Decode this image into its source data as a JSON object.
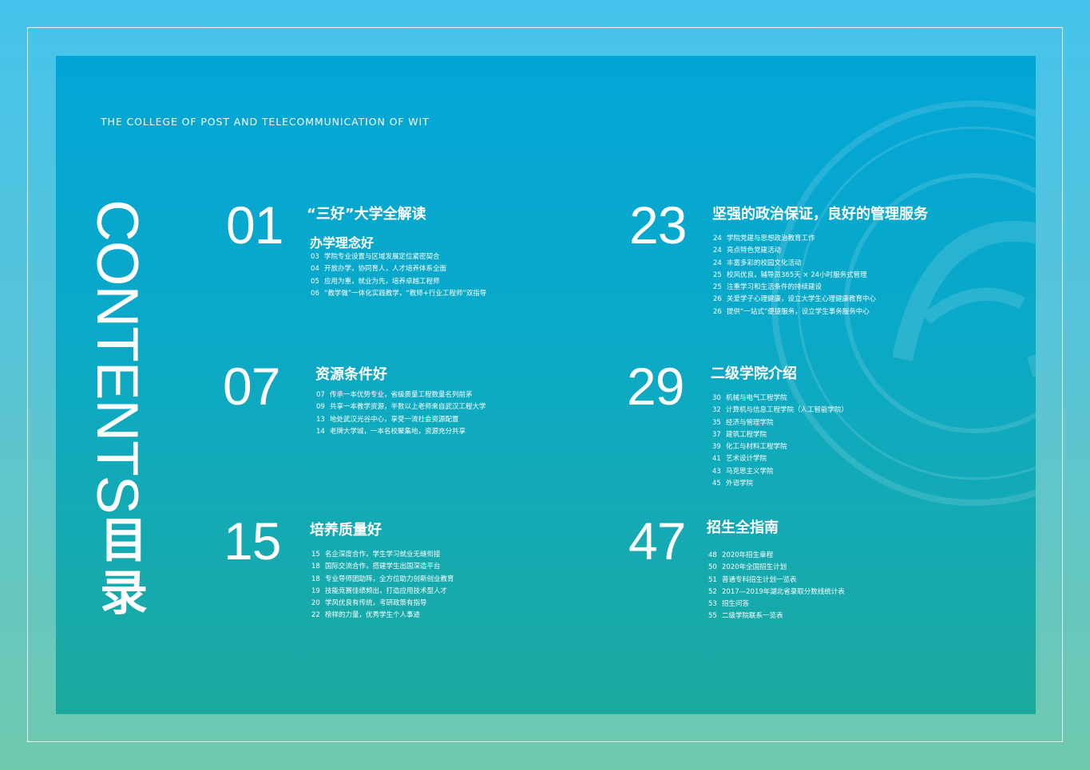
{
  "subtitle": "THE COLLEGE OF POST AND TELECOMMUNICATION OF WIT",
  "contents_word": "CONTENTS",
  "mulu_1": "目",
  "mulu_2": "录",
  "sections": [
    {
      "num": "01",
      "title": "“三好”大学全解读",
      "subtitle": "办学理念好",
      "items": [
        {
          "page": "03",
          "text": "学院专业设置与区域发展定位紧密契合"
        },
        {
          "page": "04",
          "text": "开放办学，协同育人，人才培养体系全面"
        },
        {
          "page": "05",
          "text": "应用为重，就业为先，培养卓越工程师"
        },
        {
          "page": "06",
          "text": "“教学做”一体化实践教学，“教师+行业工程师”双指导"
        }
      ]
    },
    {
      "num": "07",
      "title": "资源条件好",
      "items": [
        {
          "page": "07",
          "text": "传承一本优势专业，省级质量工程数量名列前茅"
        },
        {
          "page": "09",
          "text": "共享一本教学资源，半数以上老师来自武汉工程大学"
        },
        {
          "page": "13",
          "text": "地处武汉光谷中心，享受一流社会资源配置"
        },
        {
          "page": "14",
          "text": "老牌大学城，一本名校聚集地，资源充分共享"
        }
      ]
    },
    {
      "num": "15",
      "title": "培养质量好",
      "items": [
        {
          "page": "15",
          "text": "名企深度合作，学生学习就业无缝衔接"
        },
        {
          "page": "18",
          "text": "国际交流合作，搭建学生出国深造平台"
        },
        {
          "page": "18",
          "text": "专业导师团助阵，全方位助力创新创业教育"
        },
        {
          "page": "19",
          "text": "技能竞赛佳绩频出，打造应用技术型人才"
        },
        {
          "page": "20",
          "text": "学风优良有传统，考研政策有指导"
        },
        {
          "page": "22",
          "text": "榜样的力量，优秀学生个人事迹"
        }
      ]
    },
    {
      "num": "23",
      "title": "坚强的政治保证，良好的管理服务",
      "items": [
        {
          "page": "24",
          "text": "学院党建与思想政治教育工作"
        },
        {
          "page": "24",
          "text": "亮点特色党建活动"
        },
        {
          "page": "24",
          "text": "丰富多彩的校园文化活动"
        },
        {
          "page": "25",
          "text": "校风优良，辅导员365天 × 24小时服务式管理"
        },
        {
          "page": "25",
          "text": "注重学习和生活条件的持续建设"
        },
        {
          "page": "26",
          "text": "关爱学子心理健康，设立大学生心理健康教育中心"
        },
        {
          "page": "26",
          "text": "提供“一站式”便捷服务，设立学生事务服务中心"
        }
      ]
    },
    {
      "num": "29",
      "title": "二级学院介绍",
      "items": [
        {
          "page": "30",
          "text": "机械与电气工程学院"
        },
        {
          "page": "32",
          "text": "计算机与信息工程学院（人工智能学院）"
        },
        {
          "page": "35",
          "text": "经济与管理学院"
        },
        {
          "page": "37",
          "text": "建筑工程学院"
        },
        {
          "page": "39",
          "text": "化工与材料工程学院"
        },
        {
          "page": "41",
          "text": "艺术设计学院"
        },
        {
          "page": "43",
          "text": "马克思主义学院"
        },
        {
          "page": "45",
          "text": "外语学院"
        }
      ]
    },
    {
      "num": "47",
      "title": "招生全指南",
      "items": [
        {
          "page": "48",
          "text": "2020年招生章程"
        },
        {
          "page": "50",
          "text": "2020年全国招生计划"
        },
        {
          "page": "51",
          "text": "普通专科招生计划一览表"
        },
        {
          "page": "52",
          "text": "2017—2019年湖北省录取分数线统计表"
        },
        {
          "page": "53",
          "text": "招生问答"
        },
        {
          "page": "55",
          "text": "二级学院联系一览表"
        }
      ]
    }
  ]
}
